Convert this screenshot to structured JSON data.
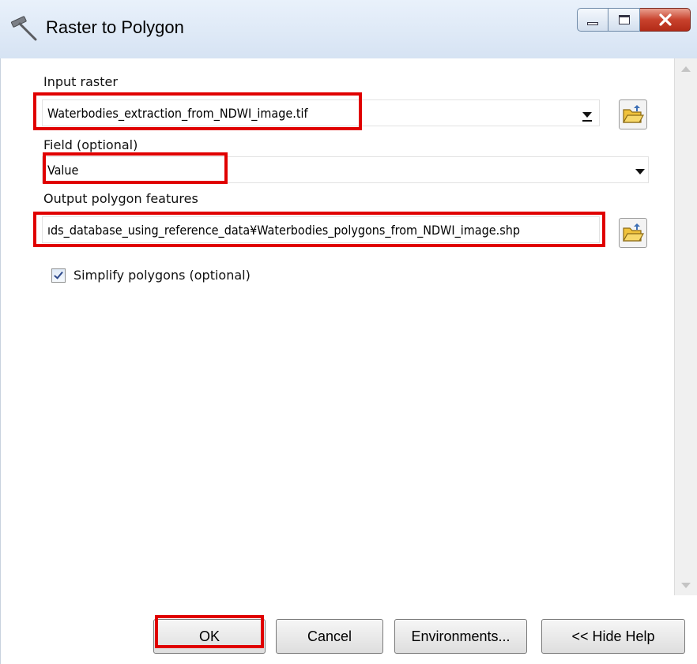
{
  "window": {
    "title": "Raster to Polygon"
  },
  "form": {
    "input_raster_label": "Input raster",
    "input_raster_value": "Waterbodies_extraction_from_NDWI_image.tif",
    "field_label": "Field (optional)",
    "field_value": "Value",
    "output_label": "Output polygon features",
    "output_value": "ıds_database_using_reference_data¥Waterbodies_polygons_from_NDWI_image.shp",
    "simplify_label": "Simplify polygons (optional)",
    "simplify_checked": true
  },
  "buttons": {
    "ok": "OK",
    "cancel": "Cancel",
    "environments": "Environments...",
    "hide_help": "<< Hide Help"
  },
  "icons": {
    "title": "hammer-icon",
    "browse": "open-folder-icon"
  },
  "colors": {
    "highlight": "#e00000",
    "titlebar": "#dae6f5",
    "close_button": "#c8422d"
  }
}
